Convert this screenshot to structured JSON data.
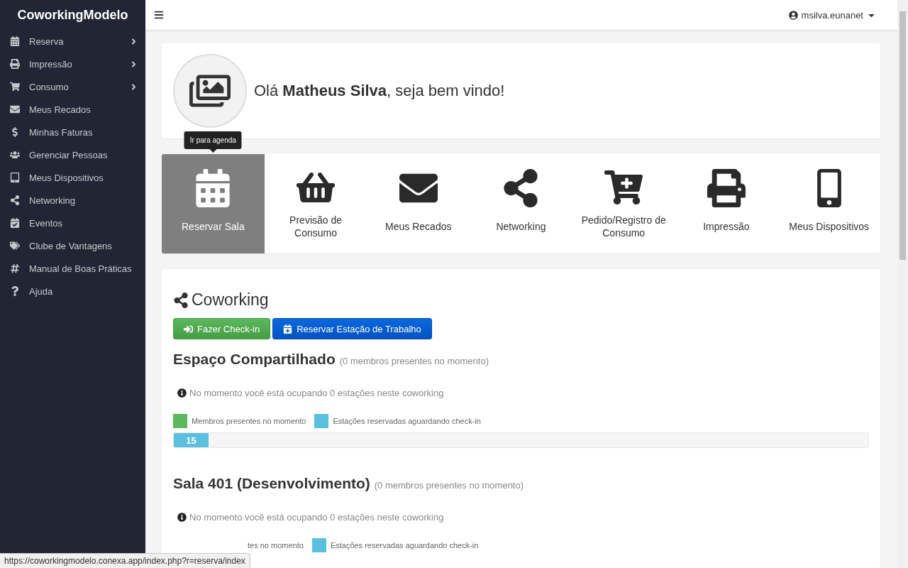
{
  "brand": "CoworkingModelo",
  "user": {
    "name": "msilva.eunanet"
  },
  "sidebar": {
    "items": [
      {
        "label": "Reserva",
        "has_submenu": true
      },
      {
        "label": "Impressão",
        "has_submenu": true
      },
      {
        "label": "Consumo",
        "has_submenu": true
      },
      {
        "label": "Meus Recados",
        "has_submenu": false
      },
      {
        "label": "Minhas Faturas",
        "has_submenu": false
      },
      {
        "label": "Gerenciar Pessoas",
        "has_submenu": false
      },
      {
        "label": "Meus Dispositivos",
        "has_submenu": false
      },
      {
        "label": "Networking",
        "has_submenu": false
      },
      {
        "label": "Eventos",
        "has_submenu": false
      },
      {
        "label": "Clube de Vantagens",
        "has_submenu": false
      },
      {
        "label": "Manual de Boas Práticas",
        "has_submenu": false
      },
      {
        "label": "Ajuda",
        "has_submenu": false
      }
    ]
  },
  "welcome": {
    "text": "Olá **Matheus Silva**, seja bem vindo!"
  },
  "shortcuts": [
    {
      "label": "Reservar Sala",
      "selected": true,
      "tooltip": "Ir para agenda"
    },
    {
      "label": "Previsão de Consumo",
      "selected": false
    },
    {
      "label": "Meus Recados",
      "selected": false
    },
    {
      "label": "Networking",
      "selected": false
    },
    {
      "label": "Pedido/Registro de Consumo",
      "selected": false
    },
    {
      "label": "Impressão",
      "selected": false
    },
    {
      "label": "Meus Dispositivos",
      "selected": false
    }
  ],
  "coworking": {
    "title": "Coworking",
    "buttons": [
      {
        "label": "Fazer Check-in",
        "kind": "success"
      },
      {
        "label": "Reservar Estação de Trabalho",
        "kind": "primary"
      }
    ],
    "rooms": [
      {
        "name": "Espaço Compartilhado",
        "members": "(0 membros presentes no momento)",
        "info": "No momento você está ocupando 0 estações neste coworking",
        "legend": [
          {
            "label": "Membros presentes no momento",
            "color": "#5cb85c"
          },
          {
            "label": "Estações reservadas aguardando check-in",
            "color": "#5bc0de"
          }
        ],
        "progress": {
          "level": 0.05,
          "label": "15"
        }
      },
      {
        "name": "Sala 401 (Desenvolvimento)",
        "members": "(0 membros presentes no momento)",
        "info": "No momento você está ocupando 0 estações neste coworking",
        "legend": [
          {
            "label": "tes no momento"
          },
          {
            "label": "Estações reservadas aguardando check-in",
            "color": "#5bc0de"
          }
        ]
      }
    ]
  },
  "status_bar": {
    "url": "https://coworkingmodelo.conexa.app/index.php?r=reserva/index"
  }
}
